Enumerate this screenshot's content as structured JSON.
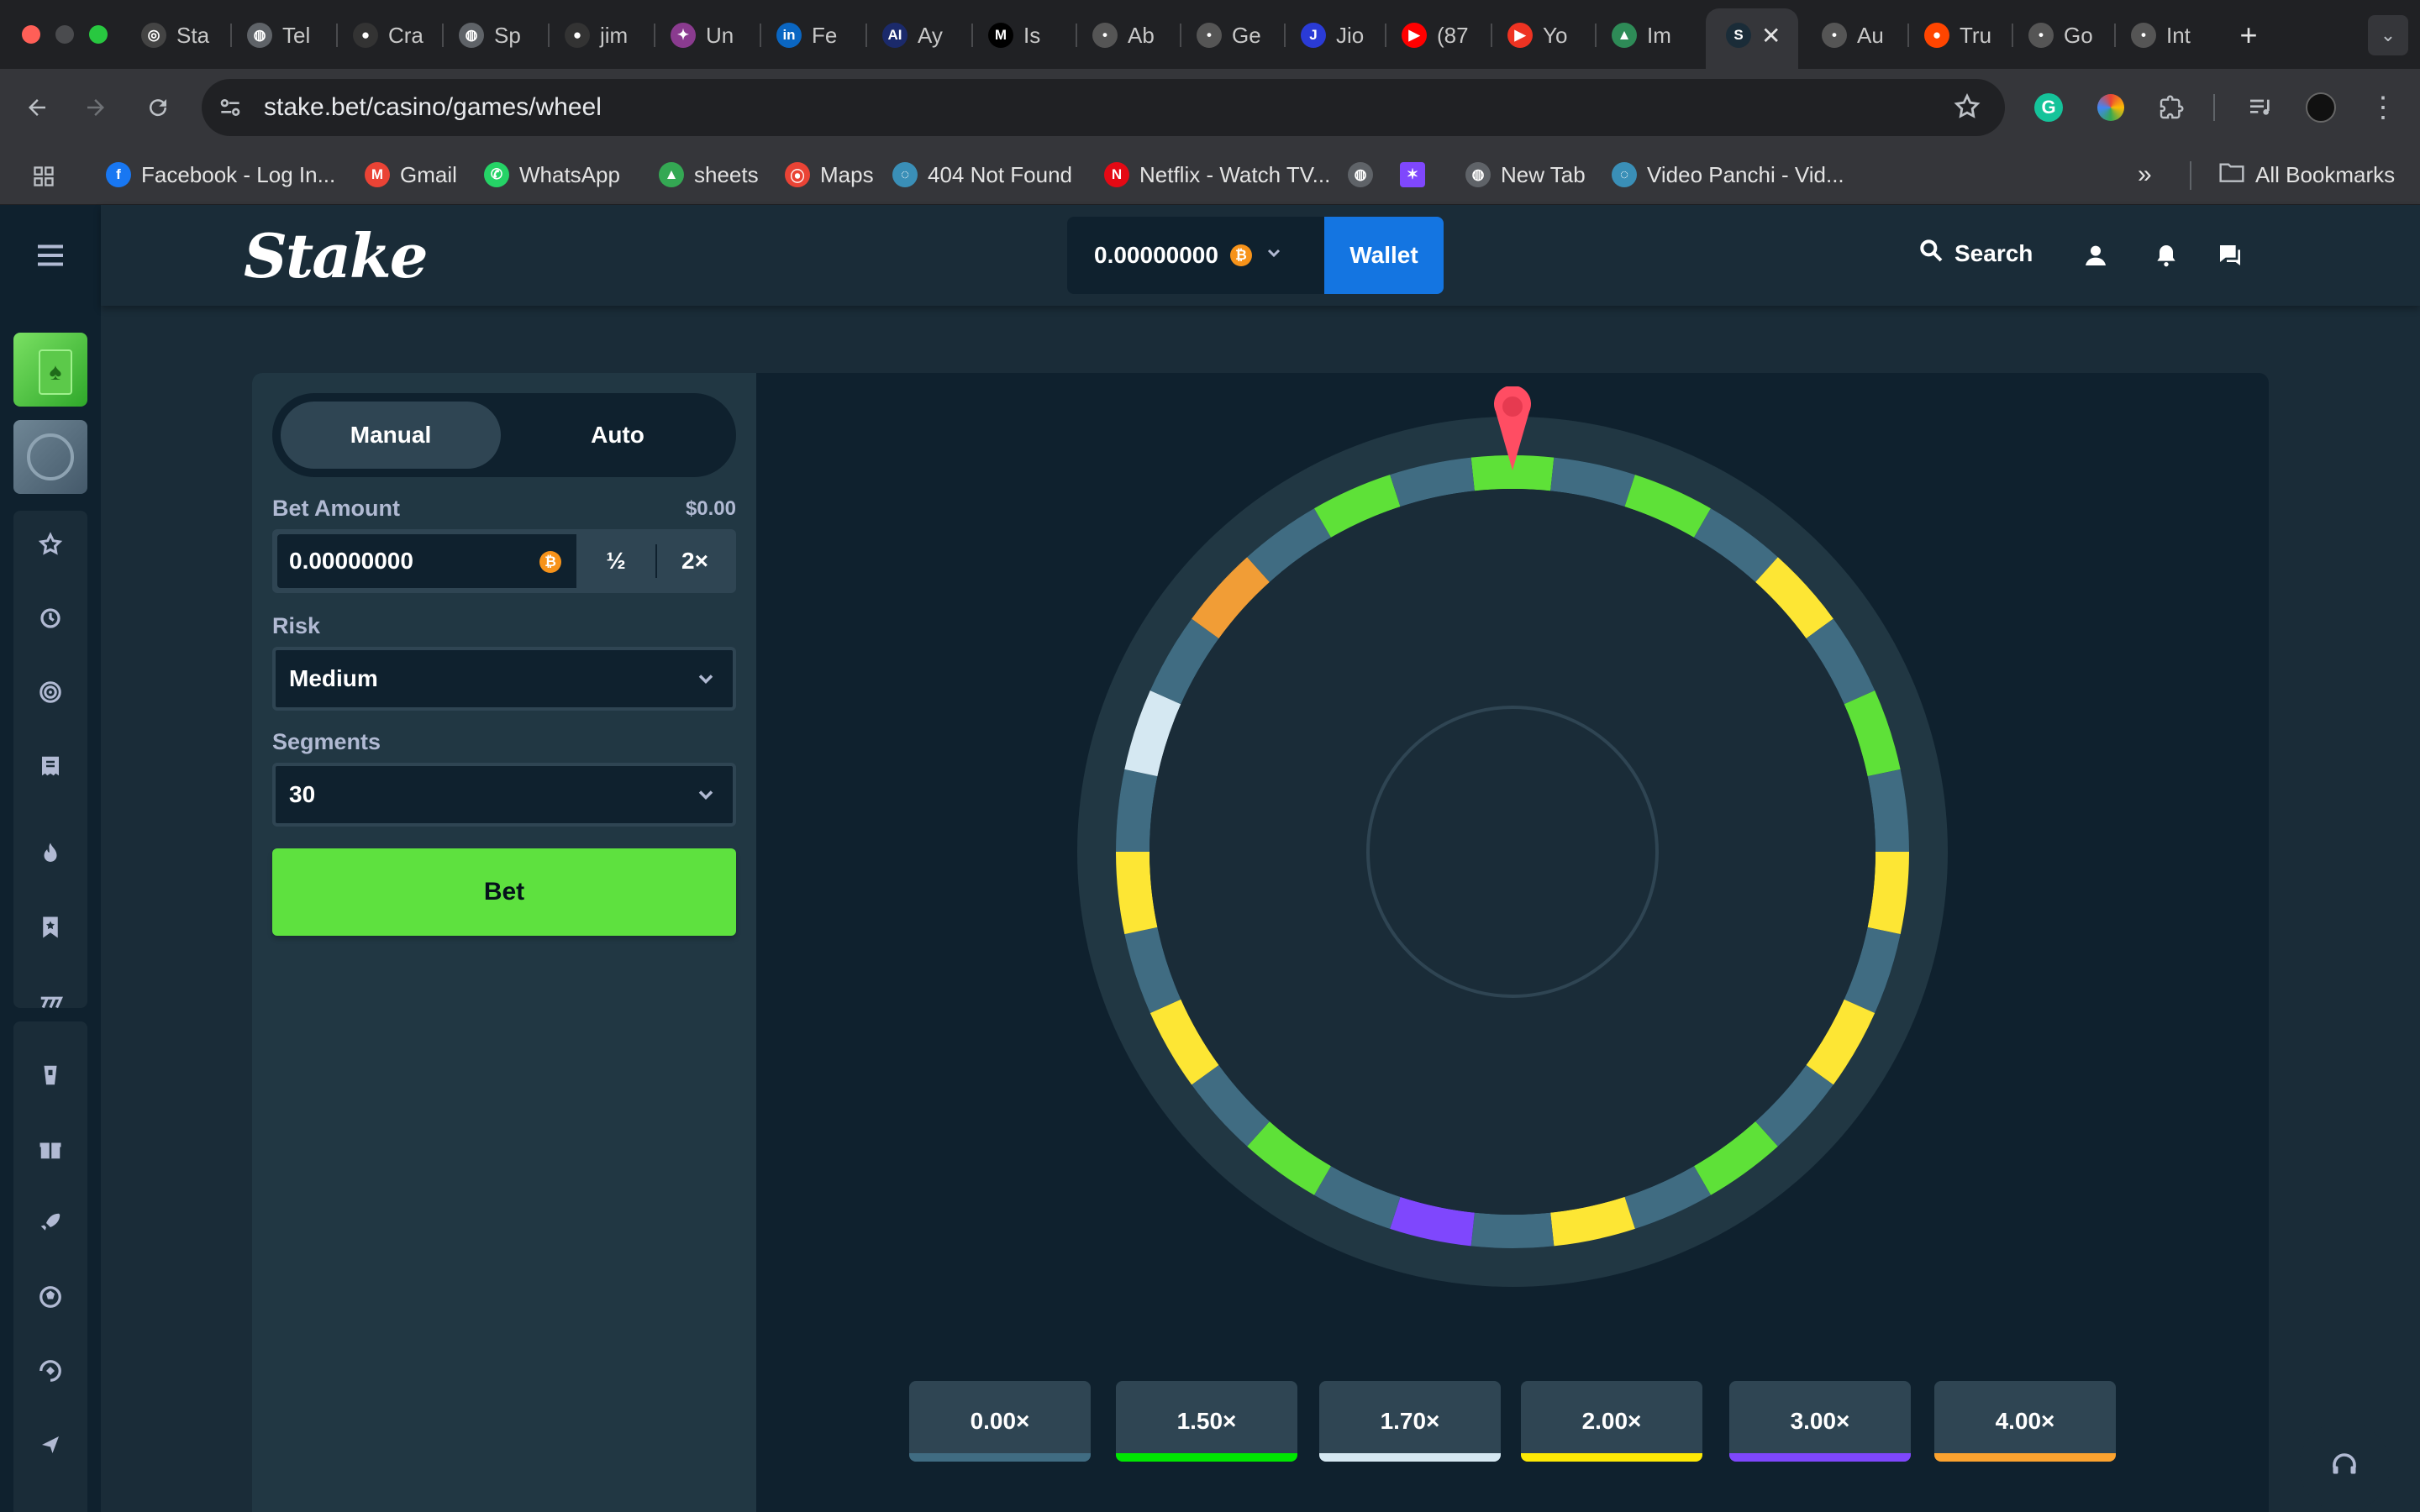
{
  "browser": {
    "tabs": [
      {
        "label": "Sta",
        "icon": "openai-icon"
      },
      {
        "label": "Tel",
        "icon": "globe-icon"
      },
      {
        "label": "Cra",
        "icon": "github-icon"
      },
      {
        "label": "Sp",
        "icon": "globe-icon"
      },
      {
        "label": "jim",
        "icon": "github-icon"
      },
      {
        "label": "Un",
        "icon": "game-icon"
      },
      {
        "label": "Fe",
        "icon": "linkedin-icon"
      },
      {
        "label": "Ay",
        "icon": "ai-icon"
      },
      {
        "label": "Is",
        "icon": "medium-icon"
      },
      {
        "label": "Ab",
        "icon": "site-icon"
      },
      {
        "label": "Ge",
        "icon": "site-icon"
      },
      {
        "label": "Jio",
        "icon": "jio-icon"
      },
      {
        "label": "(87",
        "icon": "youtube-icon"
      },
      {
        "label": "Yo",
        "icon": "youtube-music-icon"
      },
      {
        "label": "Im",
        "icon": "image-icon"
      },
      {
        "label": "",
        "icon": "stake-icon"
      },
      {
        "label": "Au",
        "icon": "site-icon"
      },
      {
        "label": "Tru",
        "icon": "reddit-icon"
      },
      {
        "label": "Go",
        "icon": "site-icon"
      },
      {
        "label": "Int",
        "icon": "site-icon"
      }
    ],
    "url": "stake.bet/casino/games/wheel",
    "bookmarks": [
      {
        "label": "Facebook - Log In...",
        "icon": "facebook-icon"
      },
      {
        "label": "Gmail",
        "icon": "gmail-icon"
      },
      {
        "label": "WhatsApp",
        "icon": "whatsapp-icon"
      },
      {
        "label": "sheets",
        "icon": "drive-icon"
      },
      {
        "label": "Maps",
        "icon": "maps-icon"
      },
      {
        "label": "404 Not Found",
        "icon": "site-icon"
      },
      {
        "label": "Netflix - Watch TV...",
        "icon": "netflix-icon"
      },
      {
        "label": "New Tab",
        "icon": "globe-icon"
      },
      {
        "label": "Video Panchi - Vid...",
        "icon": "site-icon"
      }
    ],
    "all_bookmarks": "All Bookmarks"
  },
  "header": {
    "logo": "Stake",
    "balance": "0.00000000",
    "wallet": "Wallet",
    "search": "Search"
  },
  "panel": {
    "manual": "Manual",
    "auto": "Auto",
    "bet_amount_label": "Bet Amount",
    "bet_amount_usd": "$0.00",
    "bet_amount_value": "0.00000000",
    "half": "½",
    "double": "2×",
    "risk_label": "Risk",
    "risk_value": "Medium",
    "segments_label": "Segments",
    "segments_value": "30",
    "bet_button": "Bet"
  },
  "multipliers": [
    {
      "label": "0.00×",
      "color": "#406c82"
    },
    {
      "label": "1.50×",
      "color": "#00e701"
    },
    {
      "label": "1.70×",
      "color": "#d5e8f2"
    },
    {
      "label": "2.00×",
      "color": "#fde905"
    },
    {
      "label": "3.00×",
      "color": "#7f47fd"
    },
    {
      "label": "4.00×",
      "color": "#fca32f"
    }
  ],
  "wheel": {
    "segments": [
      "green",
      "gray",
      "green",
      "gray",
      "yellow",
      "gray",
      "green",
      "gray",
      "yellow",
      "gray",
      "yellow",
      "gray",
      "green",
      "gray",
      "yellow",
      "gray",
      "purple",
      "gray",
      "green",
      "gray",
      "yellow",
      "gray",
      "yellow",
      "gray",
      "white",
      "gray",
      "orange",
      "gray",
      "green",
      "gray"
    ],
    "colors": {
      "gray": "#406c82",
      "green": "#5ee138",
      "yellow": "#fde634",
      "white": "#d5e8f2",
      "purple": "#7f47fd",
      "orange": "#f19d36"
    }
  }
}
